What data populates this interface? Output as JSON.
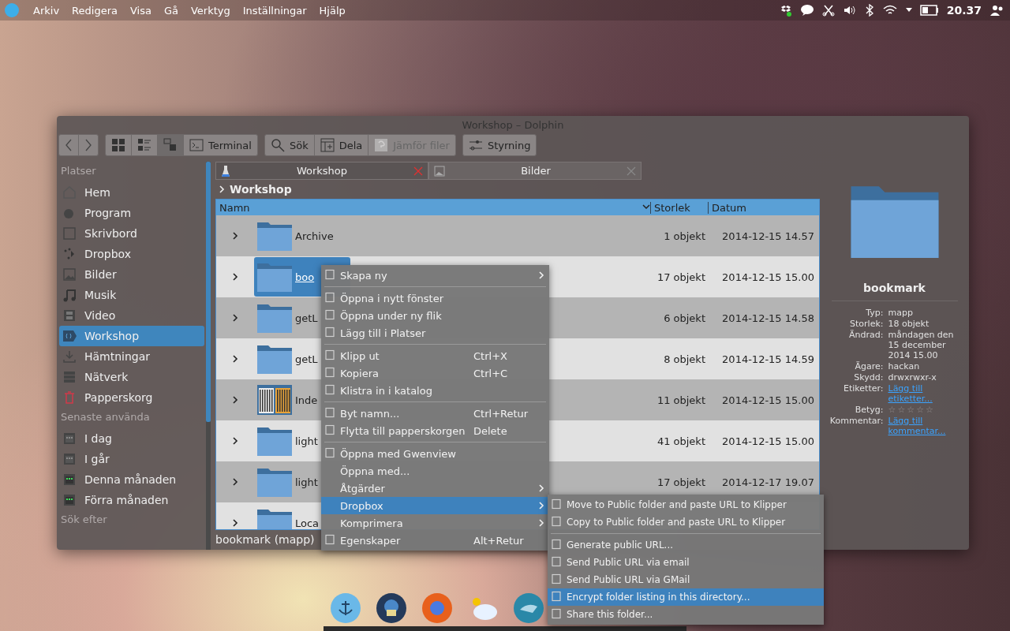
{
  "top_bar": {
    "menus": [
      "Arkiv",
      "Redigera",
      "Visa",
      "Gå",
      "Verktyg",
      "Inställningar",
      "Hjälp"
    ],
    "clock": "20.37"
  },
  "window": {
    "title": "Workshop – Dolphin"
  },
  "view_modes": [
    {
      "selected": false
    },
    {
      "selected": false
    },
    {
      "selected": true
    }
  ],
  "toolbar": [
    {
      "label": "Terminal",
      "disabled": false
    },
    {
      "label": "Sök",
      "disabled": false
    },
    {
      "label": "Dela",
      "disabled": false
    },
    {
      "label": "Jämför filer",
      "disabled": true
    },
    {
      "label": "Styrning",
      "disabled": false
    }
  ],
  "sidebar": [
    {
      "title": "Platser",
      "items": [
        {
          "label": "Hem",
          "selected": false
        },
        {
          "label": "Program",
          "selected": false
        },
        {
          "label": "Skrivbord",
          "selected": false
        },
        {
          "label": "Dropbox",
          "selected": false
        },
        {
          "label": "Bilder",
          "selected": false
        },
        {
          "label": "Musik",
          "selected": false
        },
        {
          "label": "Video",
          "selected": false
        },
        {
          "label": "Workshop",
          "selected": true
        },
        {
          "label": "Hämtningar",
          "selected": false
        },
        {
          "label": "Nätverk",
          "selected": false
        },
        {
          "label": "Papperskorg",
          "selected": false
        }
      ]
    },
    {
      "title": "Senaste använda",
      "items": [
        {
          "label": "I dag",
          "selected": false
        },
        {
          "label": "I går",
          "selected": false
        },
        {
          "label": "Denna månaden",
          "selected": false
        },
        {
          "label": "Förra månaden",
          "selected": false
        }
      ]
    },
    {
      "title": "Sök efter"
    }
  ],
  "tabs": [
    {
      "label": "Workshop",
      "selected": true
    },
    {
      "label": "Bilder",
      "selected": false
    }
  ],
  "breadcrumb": "Workshop",
  "table": {
    "columns": [
      "Namn",
      "Storlek",
      "Datum"
    ],
    "rows": [
      {
        "kind": "folder",
        "name": "Archive",
        "size": "1 objekt",
        "date": "2014-12-15 14.57",
        "selected": false
      },
      {
        "kind": "folder",
        "name": "boo",
        "size": "17 objekt",
        "date": "2014-12-15 15.00",
        "selected": true
      },
      {
        "kind": "folder",
        "name": "getL",
        "size": "6 objekt",
        "date": "2014-12-15 14.58",
        "selected": false
      },
      {
        "kind": "folder",
        "name": "getL",
        "size": "8 objekt",
        "date": "2014-12-15 14.59",
        "selected": false
      },
      {
        "kind": "thumbnail",
        "name": "Inde",
        "size": "11 objekt",
        "date": "2014-12-15 15.00",
        "selected": false
      },
      {
        "kind": "folder",
        "name": "light",
        "size": "41 objekt",
        "date": "2014-12-15 15.00",
        "selected": false
      },
      {
        "kind": "folder",
        "name": "light",
        "size": "17 objekt",
        "date": "2014-12-17 19.07",
        "selected": false
      },
      {
        "kind": "folder",
        "name": "Loca",
        "selected": false
      }
    ]
  },
  "status_bar": "bookmark (mapp)",
  "info": {
    "name": "bookmark",
    "fields": [
      {
        "kind": "text",
        "label": "Typ:",
        "value": "mapp"
      },
      {
        "kind": "text",
        "label": "Storlek:",
        "value": "18 objekt"
      },
      {
        "kind": "text",
        "label": "Ändrad:",
        "value": "måndagen den 15 december 2014 15.00"
      },
      {
        "kind": "text",
        "label": "Ägare:",
        "value": "hackan"
      },
      {
        "kind": "text",
        "label": "Skydd:",
        "value": "drwxrwxr-x"
      },
      {
        "kind": "link",
        "label": "Etiketter:",
        "value": "Lägg till etiketter..."
      },
      {
        "kind": "rating",
        "label": "Betyg:",
        "stars": 0
      },
      {
        "kind": "link",
        "label": "Kommentar:",
        "value": "Lägg till kommentar..."
      }
    ]
  },
  "context_menu": [
    [
      {
        "label": "Skapa ny",
        "icon": true,
        "submenu": true,
        "selected": false
      }
    ],
    [
      {
        "label": "Öppna i nytt fönster",
        "icon": true,
        "submenu": false,
        "selected": false
      },
      {
        "label": "Öppna under ny flik",
        "icon": true,
        "submenu": false,
        "selected": false
      },
      {
        "label": "Lägg till i Platser",
        "icon": true,
        "submenu": false,
        "selected": false
      }
    ],
    [
      {
        "label": "Klipp ut",
        "shortcut": "Ctrl+X",
        "icon": true,
        "submenu": false,
        "selected": false
      },
      {
        "label": "Kopiera",
        "shortcut": "Ctrl+C",
        "icon": true,
        "submenu": false,
        "selected": false
      },
      {
        "label": "Klistra in i katalog",
        "icon": true,
        "submenu": false,
        "selected": false
      }
    ],
    [
      {
        "label": "Byt namn...",
        "shortcut": "Ctrl+Retur",
        "icon": true,
        "submenu": false,
        "selected": false
      },
      {
        "label": "Flytta till papperskorgen",
        "shortcut": "Delete",
        "icon": true,
        "submenu": false,
        "selected": false
      }
    ],
    [
      {
        "label": "Öppna med Gwenview",
        "icon": true,
        "submenu": false,
        "selected": false
      },
      {
        "label": "Öppna med...",
        "icon": false,
        "submenu": false,
        "selected": false
      },
      {
        "label": "Åtgärder",
        "icon": false,
        "submenu": true,
        "selected": false
      },
      {
        "label": "Dropbox",
        "icon": false,
        "submenu": true,
        "selected": true
      },
      {
        "label": "Komprimera",
        "icon": false,
        "submenu": true,
        "selected": false
      },
      {
        "label": "Egenskaper",
        "shortcut": "Alt+Retur",
        "icon": true,
        "submenu": false,
        "selected": false
      }
    ]
  ],
  "submenu": [
    [
      {
        "label": "Move to Public folder and paste URL to Klipper",
        "icon": true,
        "selected": false
      },
      {
        "label": "Copy to Public folder and paste URL to Klipper",
        "icon": true,
        "selected": false
      }
    ],
    [
      {
        "label": "Generate public URL...",
        "icon": true,
        "selected": false
      },
      {
        "label": "Send Public URL via email",
        "icon": true,
        "selected": false
      },
      {
        "label": "Send Public URL via GMail",
        "icon": true,
        "selected": false
      },
      {
        "label": "Encrypt folder listing in this directory...",
        "icon": true,
        "selected": true
      },
      {
        "label": "Share this folder...",
        "icon": true,
        "selected": false
      }
    ]
  ]
}
